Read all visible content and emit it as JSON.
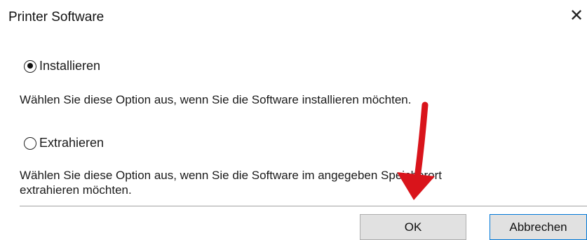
{
  "window": {
    "title": "Printer Software",
    "close_glyph": "✕"
  },
  "options": [
    {
      "label": "Installieren",
      "checked": true,
      "description": "Wählen Sie diese Option aus, wenn Sie die Software installieren möchten."
    },
    {
      "label": "Extrahieren",
      "checked": false,
      "description_line1": "Wählen Sie diese Option aus, wenn Sie die Software im angegeben Speicherort",
      "description_line2": "extrahieren möchten."
    }
  ],
  "buttons": {
    "ok": "OK",
    "cancel": "Abbrechen"
  },
  "annotation": {
    "arrow_color": "#d9141b"
  }
}
